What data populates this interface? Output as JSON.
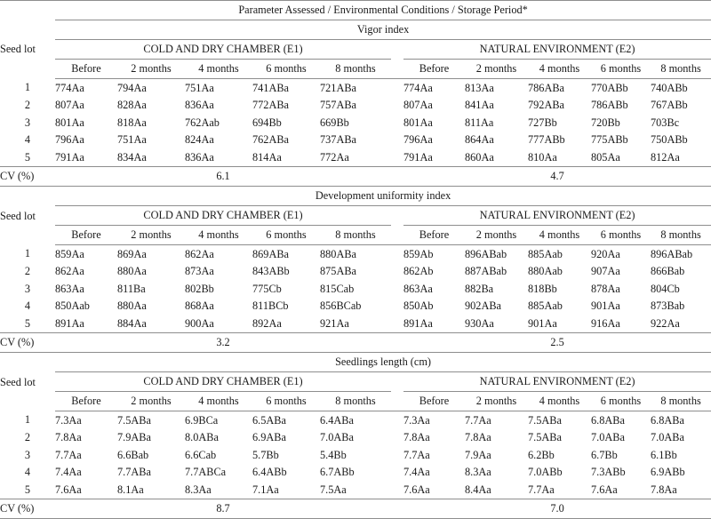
{
  "table": {
    "spanner_title": "Parameter Assessed / Environmental Conditions / Storage Period*",
    "seed_lot_label": "Seed lot",
    "cv_label": "CV (%)",
    "group_e1": "COLD AND DRY CHAMBER (E1)",
    "group_e2": "NATURAL ENVIRONMENT (E2)",
    "periods": [
      "Before",
      "2 months",
      "4 months",
      "6 months",
      "8 months"
    ],
    "sections": [
      {
        "title": "Vigor index",
        "cv_e1": "6.1",
        "cv_e2": "4.7",
        "rows": [
          {
            "lot": "1",
            "e1": [
              "774Aa",
              "794Aa",
              "751Aa",
              "741ABa",
              "721ABa"
            ],
            "e2": [
              "774Aa",
              "813Aa",
              "786ABa",
              "770ABb",
              "740ABb"
            ]
          },
          {
            "lot": "2",
            "e1": [
              "807Aa",
              "828Aa",
              "836Aa",
              "772ABa",
              "757ABa"
            ],
            "e2": [
              "807Aa",
              "841Aa",
              "792ABa",
              "786ABb",
              "767ABb"
            ]
          },
          {
            "lot": "3",
            "e1": [
              "801Aa",
              "818Aa",
              "762Aab",
              "694Bb",
              "669Bb"
            ],
            "e2": [
              "801Aa",
              "811Aa",
              "727Bb",
              "720Bb",
              "703Bc"
            ]
          },
          {
            "lot": "4",
            "e1": [
              "796Aa",
              "751Aa",
              "824Aa",
              "762ABa",
              "737ABa"
            ],
            "e2": [
              "796Aa",
              "864Aa",
              "777ABb",
              "775ABb",
              "750ABb"
            ]
          },
          {
            "lot": "5",
            "e1": [
              "791Aa",
              "834Aa",
              "836Aa",
              "814Aa",
              "772Aa"
            ],
            "e2": [
              "791Aa",
              "860Aa",
              "810Aa",
              "805Aa",
              "812Aa"
            ]
          }
        ]
      },
      {
        "title": "Development uniformity index",
        "cv_e1": "3.2",
        "cv_e2": "2.5",
        "rows": [
          {
            "lot": "1",
            "e1": [
              "859Aa",
              "869Aa",
              "862Aa",
              "869ABa",
              "880ABa"
            ],
            "e2": [
              "859Ab",
              "896ABab",
              "885Aab",
              "920Aa",
              "896ABab"
            ]
          },
          {
            "lot": "2",
            "e1": [
              "862Aa",
              "880Aa",
              "873Aa",
              "843ABb",
              "875ABa"
            ],
            "e2": [
              "862Ab",
              "887ABab",
              "880Aab",
              "907Aa",
              "866Bab"
            ]
          },
          {
            "lot": "3",
            "e1": [
              "863Aa",
              "811Ba",
              "802Bb",
              "775Cb",
              "815Cab"
            ],
            "e2": [
              "863Aa",
              "882Ba",
              "818Bb",
              "878Aa",
              "804Cb"
            ]
          },
          {
            "lot": "4",
            "e1": [
              "850Aab",
              "880Aa",
              "868Aa",
              "811BCb",
              "856BCab"
            ],
            "e2": [
              "850Ab",
              "902ABa",
              "885Aab",
              "901Aa",
              "873Bab"
            ]
          },
          {
            "lot": "5",
            "e1": [
              "891Aa",
              "884Aa",
              "900Aa",
              "892Aa",
              "921Aa"
            ],
            "e2": [
              "891Aa",
              "930Aa",
              "901Aa",
              "916Aa",
              "922Aa"
            ]
          }
        ]
      },
      {
        "title": "Seedlings length (cm)",
        "cv_e1": "8.7",
        "cv_e2": "7.0",
        "rows": [
          {
            "lot": "1",
            "e1": [
              "7.3Aa",
              "7.5ABa",
              "6.9BCa",
              "6.5ABa",
              "6.4ABa"
            ],
            "e2": [
              "7.3Aa",
              "7.7Aa",
              "7.5ABa",
              "6.8ABa",
              "6.8ABa"
            ]
          },
          {
            "lot": "2",
            "e1": [
              "7.8Aa",
              "7.9ABa",
              "8.0ABa",
              "6.9ABa",
              "7.0ABa"
            ],
            "e2": [
              "7.8Aa",
              "7.8Aa",
              "7.5ABa",
              "7.0ABa",
              "7.0ABa"
            ]
          },
          {
            "lot": "3",
            "e1": [
              "7.7Aa",
              "6.6Bab",
              "6.6Cab",
              "5.7Bb",
              "5.4Bb"
            ],
            "e2": [
              "7.7Aa",
              "7.9Aa",
              "6.2Bb",
              "6.7Bb",
              "6.1Bb"
            ]
          },
          {
            "lot": "4",
            "e1": [
              "7.4Aa",
              "7.7ABa",
              "7.7ABCa",
              "6.4ABb",
              "6.7ABb"
            ],
            "e2": [
              "7.4Aa",
              "8.3Aa",
              "7.0ABb",
              "7.3ABb",
              "6.9ABb"
            ]
          },
          {
            "lot": "5",
            "e1": [
              "7.6Aa",
              "8.1Aa",
              "8.3Aa",
              "7.1Aa",
              "7.5Aa"
            ],
            "e2": [
              "7.6Aa",
              "8.4Aa",
              "7.7Aa",
              "7.6Aa",
              "7.8Aa"
            ]
          }
        ]
      }
    ]
  }
}
